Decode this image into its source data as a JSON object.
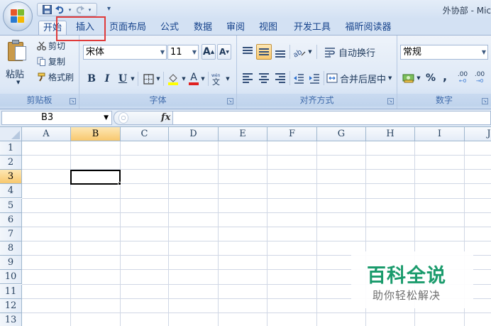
{
  "window": {
    "title": "外协部 - Mic"
  },
  "tabs": [
    {
      "label": "开始",
      "active": true
    },
    {
      "label": "插入",
      "active": false
    },
    {
      "label": "页面布局",
      "active": false
    },
    {
      "label": "公式",
      "active": false
    },
    {
      "label": "数据",
      "active": false
    },
    {
      "label": "审阅",
      "active": false
    },
    {
      "label": "视图",
      "active": false
    },
    {
      "label": "开发工具",
      "active": false
    },
    {
      "label": "福昕阅读器",
      "active": false
    }
  ],
  "ribbon": {
    "clipboard": {
      "paste": "粘贴",
      "cut": "剪切",
      "copy": "复制",
      "format_painter": "格式刷",
      "label": "剪贴板"
    },
    "font": {
      "name": "宋体",
      "size": "11",
      "bold": "B",
      "italic": "I",
      "underline": "U",
      "grow": "A",
      "shrink": "A",
      "font_color": "A",
      "label": "字体"
    },
    "alignment": {
      "wrap_text": "自动换行",
      "merge_center": "合并后居中",
      "label": "对齐方式"
    },
    "number": {
      "format": "常规",
      "percent": "%",
      "comma": ",",
      "inc_decimal": ".00",
      "dec_decimal": ".00",
      "label": "数字"
    }
  },
  "formula_bar": {
    "name_box": "B3",
    "fx": "fx",
    "formula": ""
  },
  "grid": {
    "columns": [
      "A",
      "B",
      "C",
      "D",
      "E",
      "F",
      "G",
      "H",
      "I",
      "J"
    ],
    "rows": [
      "1",
      "2",
      "3",
      "4",
      "5",
      "6",
      "7",
      "8",
      "9",
      "10",
      "11",
      "12",
      "13"
    ],
    "selected_column": "B",
    "selected_row": "3"
  },
  "watermark": {
    "title": "百科全说",
    "subtitle": "助你轻松解决"
  },
  "colors": {
    "highlight_box": "#e03a3a",
    "watermark_green": "#1a9b6c",
    "selected_header": "#f8c86e"
  }
}
